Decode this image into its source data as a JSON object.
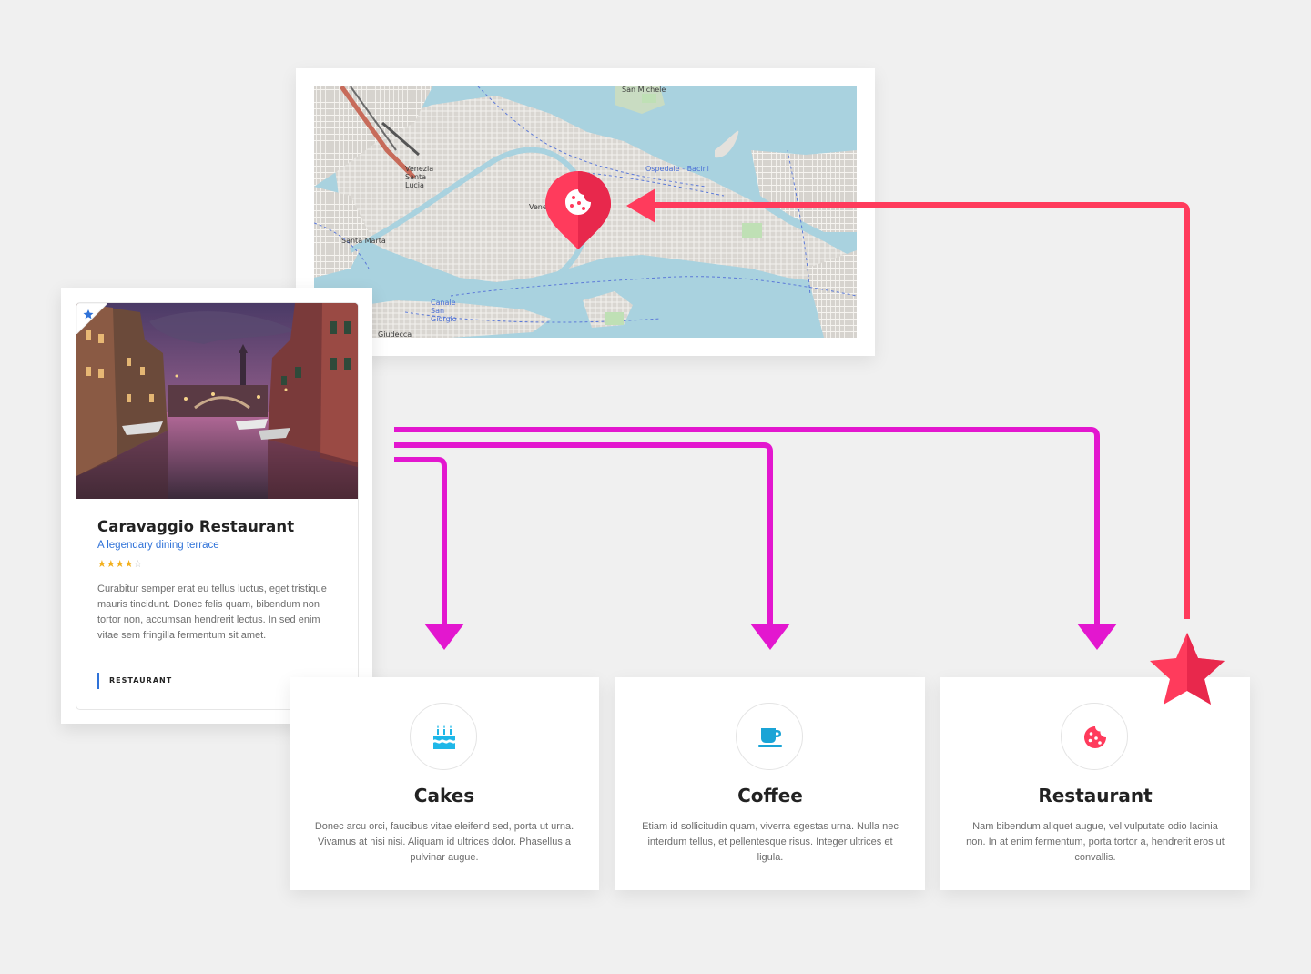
{
  "map": {
    "labels": {
      "station": "Venezia Santa Lucia",
      "santa_marta": "Santa Marta",
      "venezia": "Venezia",
      "ospedale": "Ospedale - Bacini",
      "san_michele": "San Michele",
      "san_giorgio": "Canale San Giorgio",
      "giudecca": "Giudecca"
    },
    "marker_icon": "cookie-icon",
    "marker_color": "#ff3b5c"
  },
  "listing": {
    "title": "Caravaggio Restaurant",
    "tagline": "A legendary dining terrace",
    "rating": 4,
    "rating_max": 5,
    "description": "Curabitur semper erat eu tellus luctus, eget tristique mauris tincidunt. Donec felis quam, bibendum non tortor non, accumsan hendrerit lectus. In sed enim vitae sem fringilla fermentum sit amet.",
    "category": "RESTAURANT",
    "featured_icon": "star-icon",
    "accent": "#2f72d8"
  },
  "categories": [
    {
      "title": "Cakes",
      "icon": "birthday-cake-icon",
      "description": "Donec arcu orci, faucibus vitae eleifend sed, porta ut urna. Vivamus at nisi nisi. Aliquam id ultrices dolor. Phasellus a pulvinar augue."
    },
    {
      "title": "Coffee",
      "icon": "coffee-cup-icon",
      "description": "Etiam id sollicitudin quam, viverra egestas urna. Nulla nec interdum tellus, et pellentesque risus. Integer ultrices et ligula."
    },
    {
      "title": "Restaurant",
      "icon": "cookie-icon",
      "description": "Nam bibendum aliquet augue, vel vulputate odio lacinia non. In at enim fermentum, porta tortor a, hendrerit eros ut convallis."
    }
  ],
  "colors": {
    "magenta_arrow": "#e317cf",
    "pink_arrow": "#ff3b5c",
    "cyan_icon": "#1fb7e8",
    "coffee_icon": "#1aa4d6",
    "restaurant_icon": "#ff3b5c"
  }
}
